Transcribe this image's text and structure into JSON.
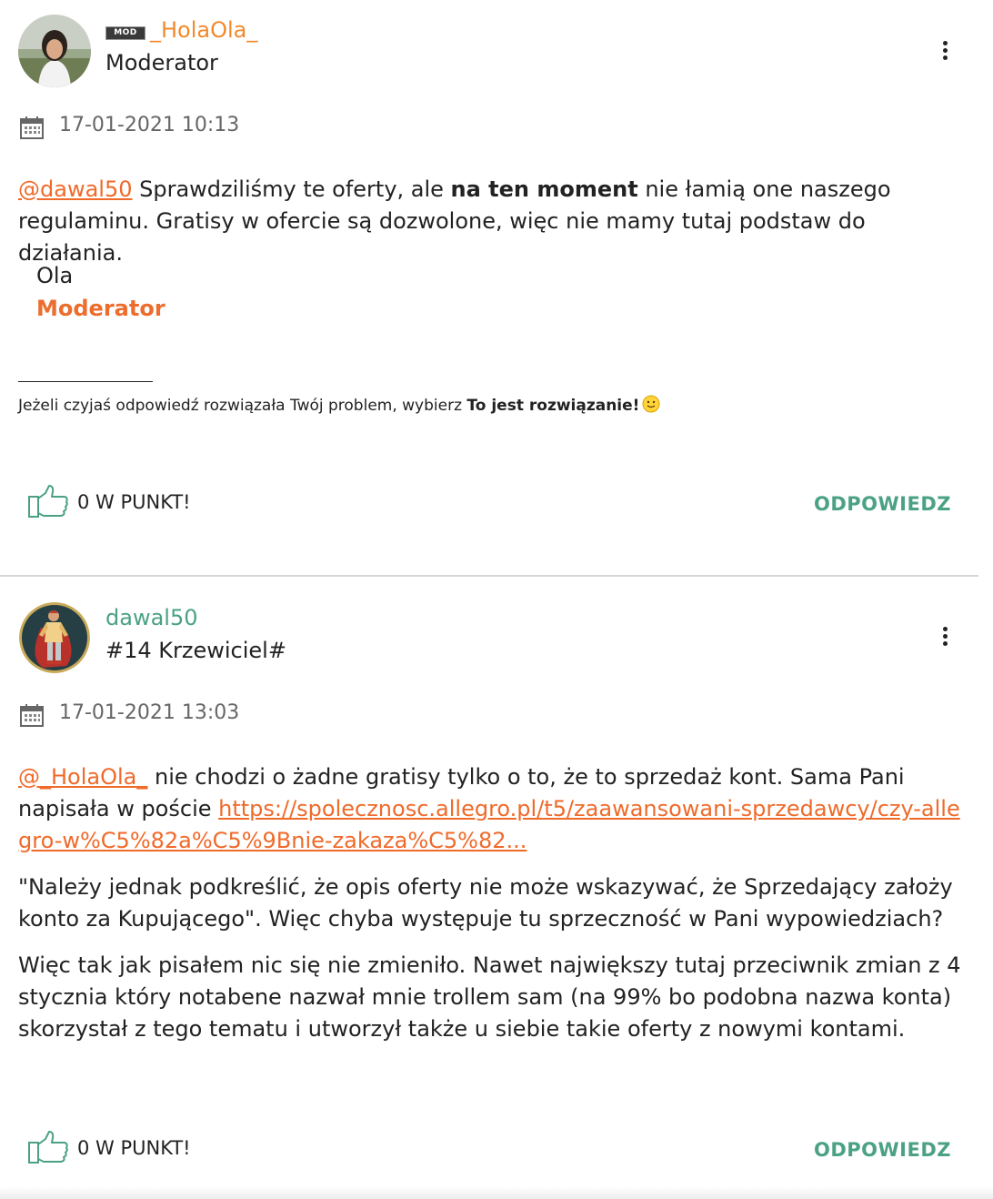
{
  "posts": [
    {
      "badge": "MOD",
      "username": "_HolaOla_",
      "rank": "Moderator",
      "date": "17-01-2021 10:13",
      "body": {
        "mention": "@dawal50",
        "text1": " Sprawdziliśmy te oferty, ale ",
        "bold": "na ten moment",
        "text2": " nie łamią one naszego regulaminu. Gratisy w ofercie są dozwolone, więc nie mamy tutaj podstaw do działania."
      },
      "signature": {
        "name": "Ola",
        "role": "Moderator",
        "footnote_text": "Jeżeli czyjaś odpowiedź rozwiązała Twój problem, wybierz ",
        "footnote_bold": "To jest rozwiązanie!"
      },
      "kudos_label": "0 W PUNKT!",
      "reply_label": "ODPOWIEDZ"
    },
    {
      "username": "dawal50",
      "rank": "#14 Krzewiciel#",
      "date": "17-01-2021 13:03",
      "body": {
        "mention": "@_HolaOla_",
        "text1": " nie chodzi o żadne gratisy tylko o to, że to sprzedaż kont. Sama Pani napisała w poście ",
        "link": "https://spolecznosc.allegro.pl/t5/zaawansowani-sprzedawcy/czy-allegro-w%C5%82a%C5%9Bnie-zakaza%C5%82...",
        "para2": "\"Należy jednak podkreślić, że opis oferty nie może wskazywać, że Sprzedający założy konto za Kupującego\". Więc chyba występuje tu sprzeczność w Pani wypowiedziach?",
        "para3": "Więc tak jak pisałem nic się nie zmieniło. Nawet największy tutaj przeciwnik zmian z 4 stycznia który notabene nazwał mnie trollem sam (na 99% bo podobna nazwa konta) skorzystał z tego tematu i utworzył także u siebie takie oferty z nowymi kontami."
      },
      "kudos_label": "0 W PUNKT!",
      "reply_label": "ODPOWIEDZ"
    }
  ],
  "colors": {
    "moderator_name": "#f28a2e",
    "user_name": "#4ba185",
    "link": "#f06a2a",
    "reply": "#4ba185",
    "thumb_icon": "#4ba185"
  },
  "icons": [
    "calendar-icon",
    "thumbs-up-icon",
    "kebab-menu-icon",
    "smiley-icon"
  ]
}
